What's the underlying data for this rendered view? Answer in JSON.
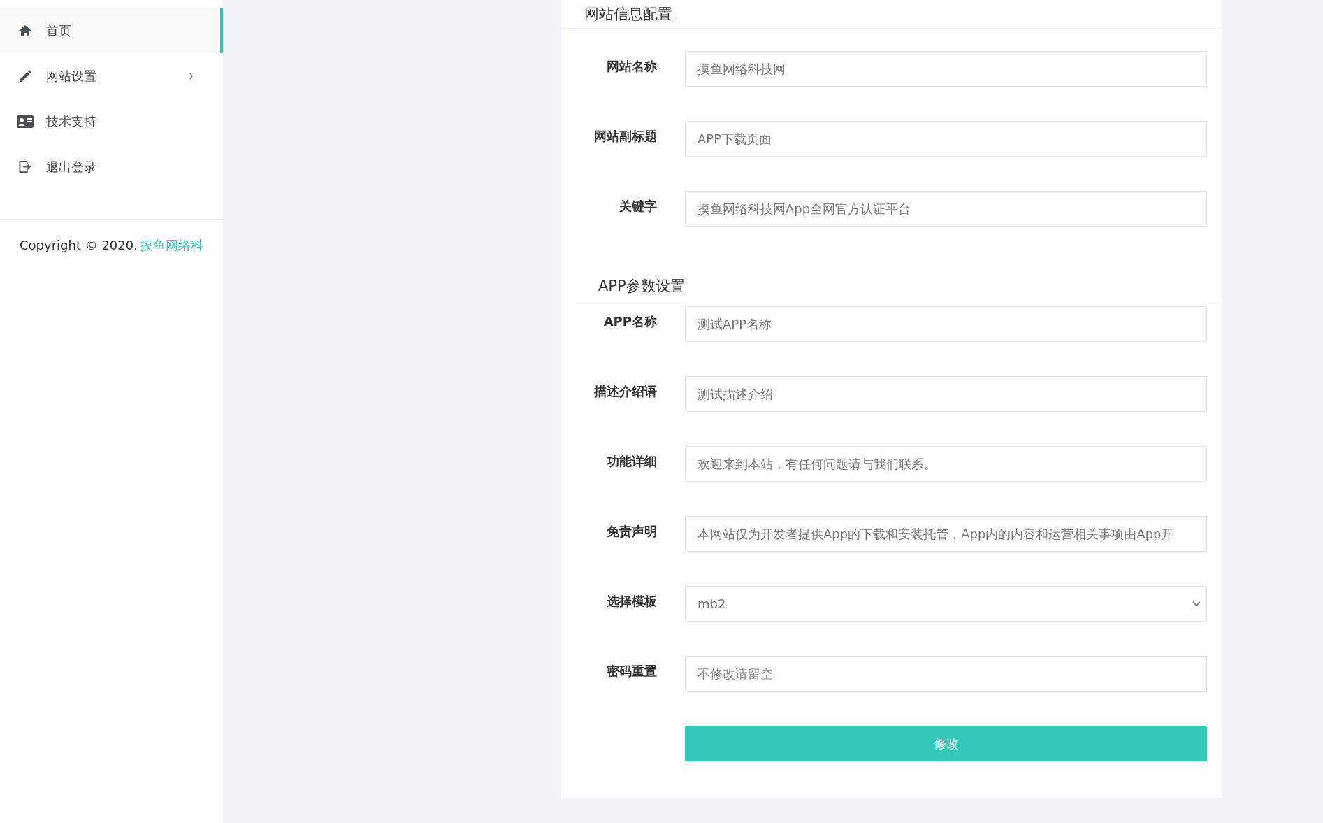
{
  "sidebar": {
    "items": [
      {
        "label": "首页",
        "selected": true,
        "has_submenu": false
      },
      {
        "label": "网站设置",
        "selected": false,
        "has_submenu": true
      },
      {
        "label": "技术支持",
        "selected": false,
        "has_submenu": false
      },
      {
        "label": "退出登录",
        "selected": false,
        "has_submenu": false
      }
    ],
    "copyright": {
      "text": "Copyright © 2020.",
      "link": "摸鱼网络科"
    }
  },
  "sections": [
    {
      "title": "网站信息配置",
      "fields": [
        {
          "label": "网站名称",
          "kind": "text",
          "value": "摸鱼网络科技网"
        },
        {
          "label": "网站副标题",
          "kind": "text",
          "value": "APP下载页面"
        },
        {
          "label": "关键字",
          "kind": "text",
          "value": "摸鱼网络科技网App全网官方认证平台"
        }
      ]
    },
    {
      "title": "APP参数设置",
      "fields": [
        {
          "label": "APP名称",
          "kind": "text",
          "value": "测试APP名称"
        },
        {
          "label": "描述介绍语",
          "kind": "text",
          "value": "测试描述介绍"
        },
        {
          "label": "功能详细",
          "kind": "text",
          "value": "欢迎来到本站，有任何问题请与我们联系。"
        },
        {
          "label": "免责声明",
          "kind": "text",
          "value": "本网站仅为开发者提供App的下载和安装托管，App内的内容和运营相关事项由App开"
        },
        {
          "label": "选择模板",
          "kind": "select",
          "value": "mb2"
        },
        {
          "label": "密码重置",
          "kind": "text",
          "placeholder": "不修改请留空"
        }
      ]
    }
  ],
  "submit": "修改"
}
